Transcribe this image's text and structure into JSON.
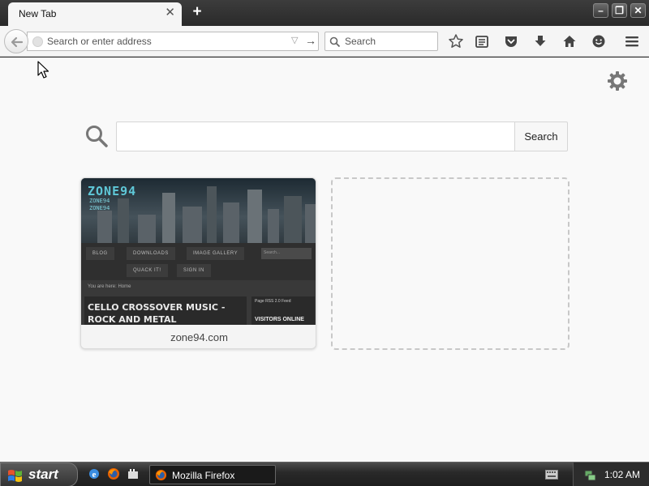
{
  "browser": {
    "tab": {
      "title": "New Tab",
      "close_glyph": "✕"
    },
    "new_tab_glyph": "+",
    "window_controls": {
      "minimize": "–",
      "restore": "❐",
      "close": "✕"
    },
    "urlbar": {
      "placeholder": "Search or enter address",
      "value": "",
      "dropdown_glyph": "▽",
      "go_glyph": "→"
    },
    "searchbar": {
      "placeholder": "Search"
    },
    "toolbar_icons": [
      "bookmark-star-icon",
      "reading-list-icon",
      "pocket-icon",
      "download-icon",
      "home-icon",
      "smiley-feedback-icon",
      "menu-icon"
    ]
  },
  "newtab": {
    "search_button": "Search",
    "tiles": [
      {
        "label": "zone94.com",
        "thumbnail": {
          "logo": "ZONE94",
          "logo_sub": [
            "ZONE94",
            "ZONE94"
          ],
          "nav": [
            "BLOG",
            "DOWNLOADS",
            "IMAGE GALLERY",
            "QUACK IT!",
            "SIGN IN"
          ],
          "search_placeholder": "Search...",
          "breadcrumb": "You are here:  Home",
          "headline": "CELLO CROSSOVER MUSIC - ROCK AND METAL",
          "rss": "Page RSS 2.0 Feed",
          "side_title": "VISITORS ONLINE"
        }
      }
    ]
  },
  "taskbar": {
    "start_label": "start",
    "task_button": "Mozilla Firefox",
    "clock": "1:02 AM"
  }
}
